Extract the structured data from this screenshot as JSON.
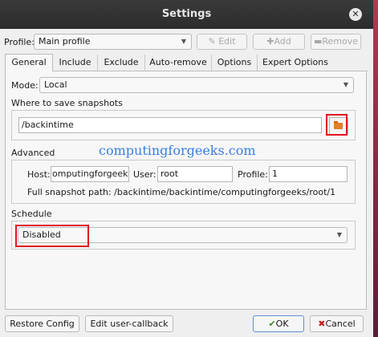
{
  "window": {
    "title": "Settings",
    "close_glyph": "✕"
  },
  "profile": {
    "label": "Profile:",
    "value": "Main profile"
  },
  "toolbar": {
    "edit": "Edit",
    "add": "Add",
    "remove": "Remove"
  },
  "tabs": [
    "General",
    "Include",
    "Exclude",
    "Auto-remove",
    "Options",
    "Expert Options"
  ],
  "general": {
    "mode_label": "Mode:",
    "mode_value": "Local",
    "snapshots_label": "Where to save snapshots",
    "path": "/backintime",
    "advanced_label": "Advanced",
    "host_label": "Host:",
    "host_value": "omputingforgeeks",
    "user_label": "User:",
    "user_value": "root",
    "profile_label": "Profile:",
    "profile_value": "1",
    "full_path": "Full snapshot path: /backintime/backintime/computingforgeeks/root/1",
    "schedule_label": "Schedule",
    "schedule_value": "Disabled"
  },
  "watermark": "computingforgeeks.com",
  "buttons": {
    "restore": "Restore Config",
    "edit_callback": "Edit user-callback",
    "ok": "OK",
    "cancel": "Cancel"
  },
  "icons": [
    "close-icon",
    "edit-icon",
    "add-icon",
    "remove-icon",
    "folder-icon",
    "ok-check-icon",
    "cancel-x-icon"
  ],
  "colors": {
    "highlight": "#e0151f",
    "titlebar": "#2c2c2c",
    "watermark": "#3a7ee0"
  }
}
